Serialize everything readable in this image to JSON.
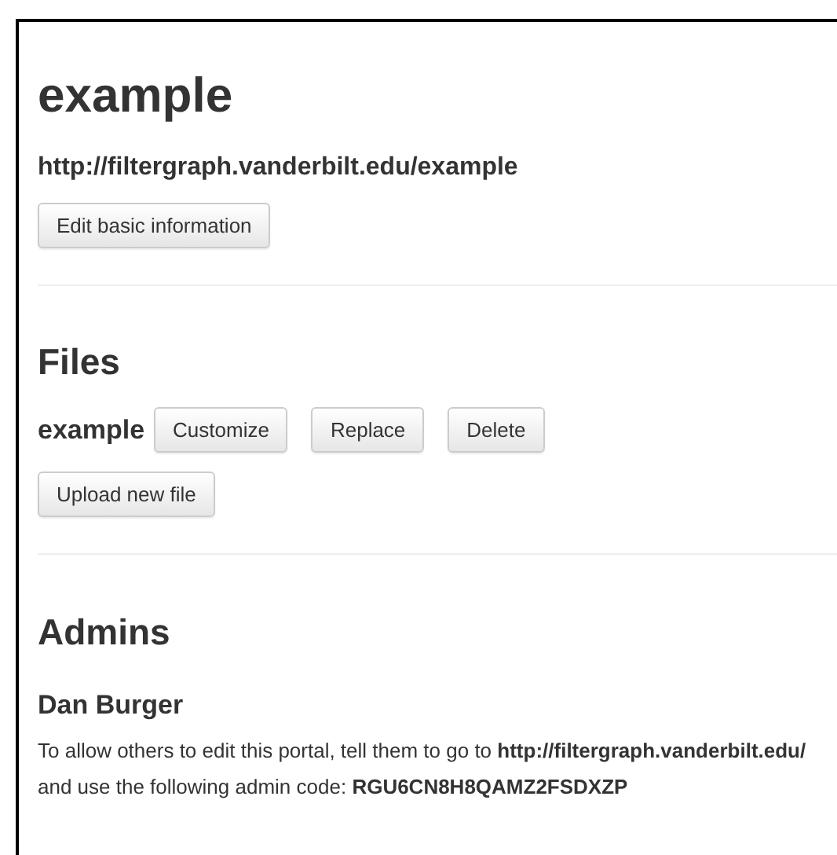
{
  "portal": {
    "title": "example",
    "url": "http://filtergraph.vanderbilt.edu/example",
    "edit_button": "Edit basic information"
  },
  "files": {
    "heading": "Files",
    "items": [
      {
        "name": "example",
        "buttons": [
          "Customize",
          "Replace",
          "Delete"
        ]
      }
    ],
    "upload_button": "Upload new file"
  },
  "admins": {
    "heading": "Admins",
    "names": [
      "Dan Burger"
    ],
    "instructions": "To allow others to edit this portal, tell them to go to **http://filtergraph.vanderbilt.edu/** and use the following admin code: **RGU6CN8H8QAMZ2FSDXZP**"
  }
}
